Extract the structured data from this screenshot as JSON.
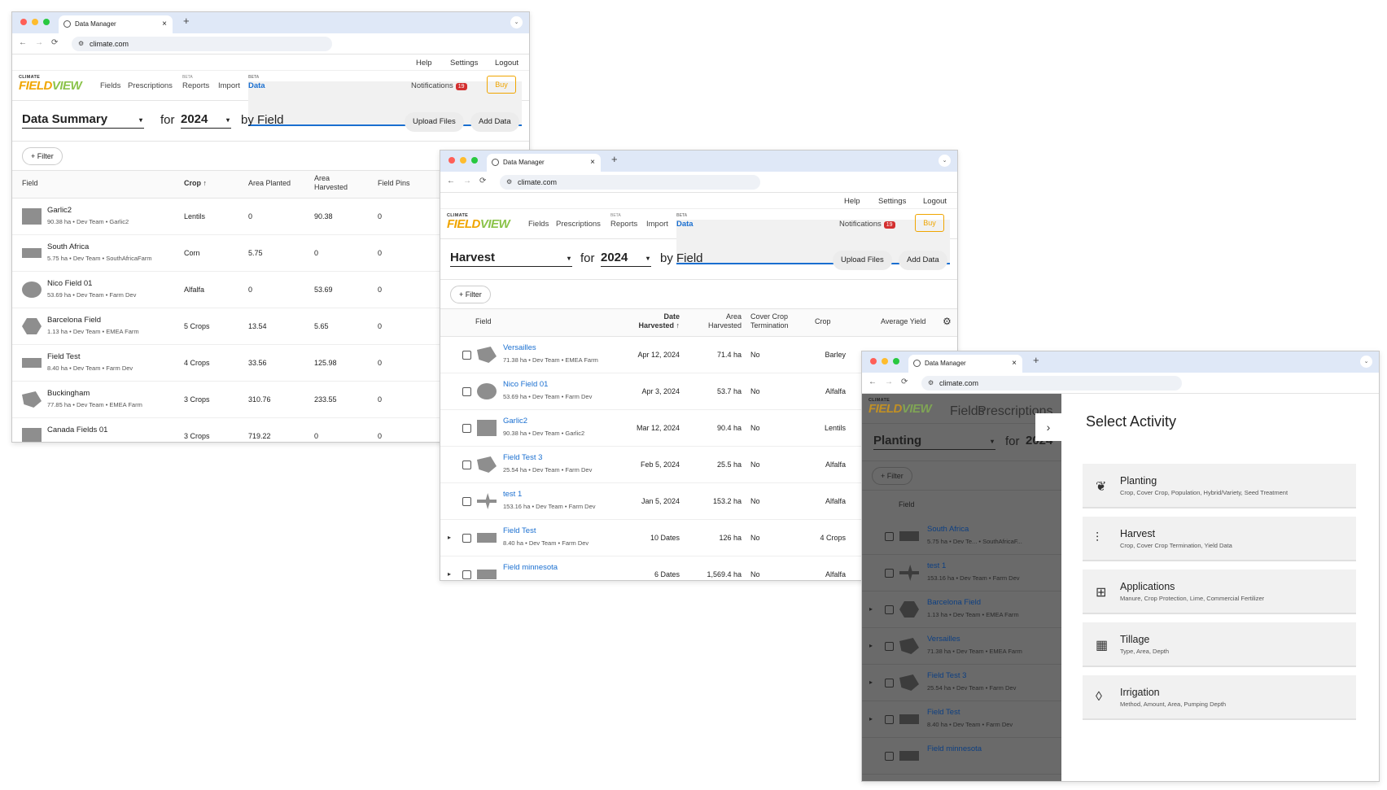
{
  "browser": {
    "tab_title": "Data Manager",
    "url": "climate.com",
    "new_tab": "+",
    "tab_close": "×",
    "back": "←",
    "forward": "→",
    "reload": "⟳",
    "tabs_menu": "⌄"
  },
  "util": {
    "help": "Help",
    "settings": "Settings",
    "logout": "Logout"
  },
  "brand": {
    "top": "CLIMATE",
    "name_a": "FIELD",
    "name_b": "VIEW"
  },
  "nav": {
    "fields": "Fields",
    "prescriptions": "Prescriptions",
    "reports": "Reports",
    "import": "Import",
    "data": "Data",
    "notifications": "Notifications",
    "notif_count": "19",
    "buy": "Buy"
  },
  "common": {
    "for": "for",
    "by_field": "by Field",
    "upload": "Upload Files",
    "add": "Add Data",
    "filter": "+ Filter",
    "dd": "▾"
  },
  "w1": {
    "selector": "Data Summary",
    "year": "2024",
    "headers": {
      "field": "Field",
      "crop": "Crop ↑",
      "area_planted": "Area Planted",
      "area_harvested": "Area Harvested",
      "field_pins": "Field Pins"
    },
    "rows": [
      {
        "name": "Garlic2",
        "meta": "90.38 ha • Dev Team • Garlic2",
        "crop": "Lentils",
        "planted": "0",
        "harvested": "90.38",
        "pins": "0",
        "shape": "square"
      },
      {
        "name": "South Africa",
        "meta": "5.75 ha • Dev Team • SouthAfricaFarm",
        "crop": "Corn",
        "planted": "5.75",
        "harvested": "0",
        "pins": "0",
        "shape": "flat"
      },
      {
        "name": "Nico Field 01",
        "meta": "53.69 ha • Dev Team • Farm Dev",
        "crop": "Alfalfa",
        "planted": "0",
        "harvested": "53.69",
        "pins": "0",
        "shape": "circle"
      },
      {
        "name": "Barcelona Field",
        "meta": "1.13 ha • Dev Team • EMEA Farm",
        "crop": "5 Crops",
        "planted": "13.54",
        "harvested": "5.65",
        "pins": "0",
        "shape": "hex"
      },
      {
        "name": "Field Test",
        "meta": "8.40 ha • Dev Team • Farm Dev",
        "crop": "4 Crops",
        "planted": "33.56",
        "harvested": "125.98",
        "pins": "0",
        "shape": "flat"
      },
      {
        "name": "Buckingham",
        "meta": "77.85 ha • Dev Team • EMEA Farm",
        "crop": "3 Crops",
        "planted": "310.76",
        "harvested": "233.55",
        "pins": "0",
        "shape": "poly"
      },
      {
        "name": "Canada Fields 01",
        "meta": "",
        "crop": "3 Crops",
        "planted": "719.22",
        "harvested": "0",
        "pins": "0",
        "shape": "square"
      }
    ]
  },
  "w2": {
    "selector": "Harvest",
    "year": "2024",
    "headers": {
      "field": "Field",
      "date": "Date Harvested ↑",
      "area": "Area Harvested",
      "cover": "Cover Crop Termination",
      "crop": "Crop",
      "yield": "Average Yield"
    },
    "rows": [
      {
        "name": "Versailles",
        "meta": "71.38 ha • Dev Team • EMEA Farm",
        "date": "Apr 12, 2024",
        "area": "71.4 ha",
        "cover": "No",
        "crop": "Barley",
        "shape": "poly",
        "exp": ""
      },
      {
        "name": "Nico Field 01",
        "meta": "53.69 ha • Dev Team • Farm Dev",
        "date": "Apr 3, 2024",
        "area": "53.7 ha",
        "cover": "No",
        "crop": "Alfalfa",
        "shape": "circle",
        "exp": ""
      },
      {
        "name": "Garlic2",
        "meta": "90.38 ha • Dev Team • Garlic2",
        "date": "Mar 12, 2024",
        "area": "90.4 ha",
        "cover": "No",
        "crop": "Lentils",
        "shape": "square",
        "exp": ""
      },
      {
        "name": "Field Test 3",
        "meta": "25.54 ha • Dev Team • Farm Dev",
        "date": "Feb 5, 2024",
        "area": "25.5 ha",
        "cover": "No",
        "crop": "Alfalfa",
        "shape": "poly",
        "exp": ""
      },
      {
        "name": "test 1",
        "meta": "153.16 ha • Dev Team • Farm Dev",
        "date": "Jan 5, 2024",
        "area": "153.2 ha",
        "cover": "No",
        "crop": "Alfalfa",
        "shape": "plane",
        "exp": ""
      },
      {
        "name": "Field Test",
        "meta": "8.40 ha • Dev Team • Farm Dev",
        "date": "10 Dates",
        "area": "126 ha",
        "cover": "No",
        "crop": "4 Crops",
        "shape": "flat",
        "exp": "▸"
      },
      {
        "name": "Field minnesota",
        "meta": "",
        "date": "6 Dates",
        "area": "1,569.4 ha",
        "cover": "No",
        "crop": "Alfalfa",
        "shape": "flat",
        "exp": "▸"
      }
    ]
  },
  "w3": {
    "selector": "Planting",
    "year": "2024",
    "field_header": "Field",
    "chevron": "›",
    "rows": [
      {
        "name": "South Africa",
        "meta": "5.75 ha • Dev Te... • SouthAfricaF...",
        "shape": "flat",
        "exp": ""
      },
      {
        "name": "test 1",
        "meta": "153.16 ha • Dev Team • Farm Dev",
        "shape": "plane",
        "exp": ""
      },
      {
        "name": "Barcelona Field",
        "meta": "1.13 ha • Dev Team • EMEA Farm",
        "shape": "hex",
        "exp": "▸"
      },
      {
        "name": "Versailles",
        "meta": "71.38 ha • Dev Team • EMEA Farm",
        "shape": "poly",
        "exp": "▸"
      },
      {
        "name": "Field Test 3",
        "meta": "25.54 ha • Dev Team • Farm Dev",
        "shape": "poly",
        "exp": "▸"
      },
      {
        "name": "Field Test",
        "meta": "8.40 ha • Dev Team • Farm Dev",
        "shape": "flat",
        "exp": "▸"
      },
      {
        "name": "Field minnesota",
        "meta": "",
        "shape": "flat",
        "exp": ""
      }
    ],
    "panel_title": "Select Activity",
    "activities": [
      {
        "name": "Planting",
        "desc": "Crop, Cover Crop, Population, Hybrid/Variety, Seed Treatment",
        "icon": "❦",
        "icon_name": "seedling-icon"
      },
      {
        "name": "Harvest",
        "desc": "Crop, Cover Crop Termination, Yield Data",
        "icon": "⫶",
        "icon_name": "harvest-icon"
      },
      {
        "name": "Applications",
        "desc": "Manure, Crop Protection, Lime, Commercial Fertilizer",
        "icon": "⊞",
        "icon_name": "applications-icon"
      },
      {
        "name": "Tillage",
        "desc": "Type, Area, Depth",
        "icon": "▦",
        "icon_name": "tillage-icon"
      },
      {
        "name": "Irrigation",
        "desc": "Method, Amount, Area, Pumping Depth",
        "icon": "◊",
        "icon_name": "water-drop-icon"
      }
    ]
  },
  "colors": {
    "brand_orange": "#f0a500",
    "brand_green": "#8bc34a",
    "link_blue": "#1a6fd0",
    "badge_red": "#d32f2f"
  }
}
